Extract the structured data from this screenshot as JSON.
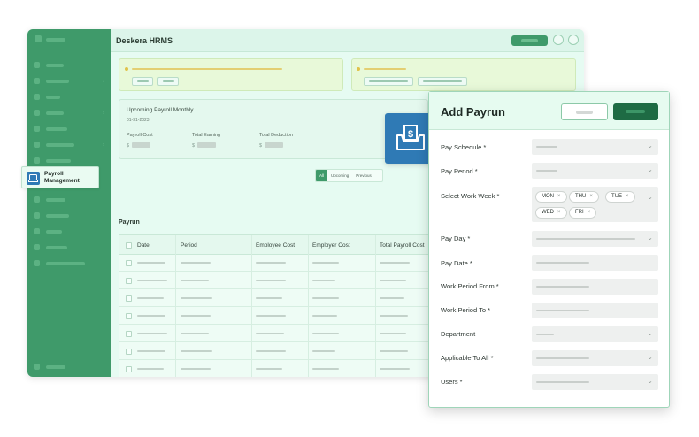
{
  "app": {
    "title": "Deskera HRMS",
    "upcoming_title": "Upcoming Payroll Monthly",
    "upcoming_date": "01-31-2023",
    "summary": [
      {
        "label": "Payroll Cost",
        "currency": "$"
      },
      {
        "label": "Total Earning",
        "currency": "$"
      },
      {
        "label": "Total Deduction",
        "currency": "$"
      }
    ],
    "filters": [
      "All",
      "Upcoming",
      "Previous"
    ],
    "active_filter": "All",
    "table_title": "Payrun",
    "columns": [
      "Date",
      "Period",
      "Employee Cost",
      "Employer Cost",
      "Total Payroll Cost"
    ]
  },
  "badge": {
    "line1": "Payroll",
    "line2": "Management"
  },
  "icons": {
    "money": "money-tray-icon",
    "badge": "payroll-icon"
  },
  "modal": {
    "title": "Add Payrun",
    "fields": [
      {
        "label": "Pay Schedule *"
      },
      {
        "label": "Pay Period *"
      },
      {
        "label": "Select Work Week *"
      },
      {
        "label": "Pay Day *"
      },
      {
        "label": "Pay Date *"
      },
      {
        "label": "Work Period From *"
      },
      {
        "label": "Work Period To *"
      },
      {
        "label": "Department"
      },
      {
        "label": "Applicable To All *"
      },
      {
        "label": "Users *"
      }
    ],
    "work_week_tags": [
      "MON",
      "THU",
      "TUE",
      "WED",
      "FRI"
    ],
    "tag_remove": "×",
    "dropdown_glyph": "⌄"
  },
  "colors": {
    "sidebar": "#3f9a6a",
    "primary": "#1e6b44",
    "icon_blue": "#2f7ab5",
    "panel": "#e6fbf2"
  }
}
